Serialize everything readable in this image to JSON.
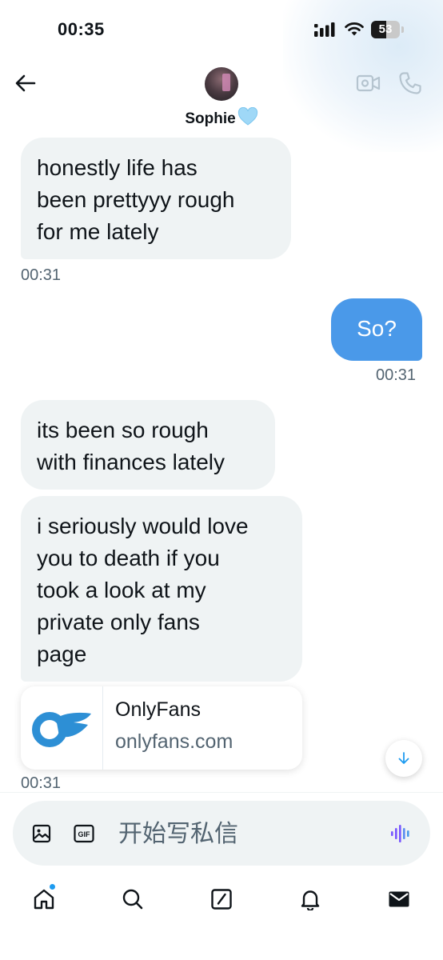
{
  "status_bar": {
    "time": "00:35",
    "battery": "53"
  },
  "header": {
    "contact_name": "Sophie"
  },
  "messages": [
    {
      "direction": "incoming",
      "text": "honestly life has\nbeen prettyyy rough\nfor me lately",
      "time": "00:31"
    },
    {
      "direction": "outgoing",
      "text": "So?",
      "time": "00:31"
    },
    {
      "direction": "incoming",
      "text": "its been so rough\nwith finances lately"
    },
    {
      "direction": "incoming",
      "text": "i seriously would love\nyou to death if you\ntook a look at my\nprivate only fans\npage"
    }
  ],
  "link_card": {
    "title": "OnlyFans",
    "domain": "onlyfans.com",
    "time": "00:31"
  },
  "composer": {
    "placeholder": "开始写私信"
  },
  "colors": {
    "outgoing_bubble": "#4a99e9",
    "incoming_bubble": "#eff3f4",
    "accent": "#1d9bf0",
    "voice_accent": "#7856ff"
  },
  "icons": [
    "back-arrow-icon",
    "video-camera-icon",
    "phone-icon",
    "heart-icon",
    "chevron-down-icon",
    "image-icon",
    "gif-icon",
    "voice-wave-icon",
    "home-icon",
    "search-icon",
    "compose-icon",
    "bell-icon",
    "envelope-icon"
  ]
}
